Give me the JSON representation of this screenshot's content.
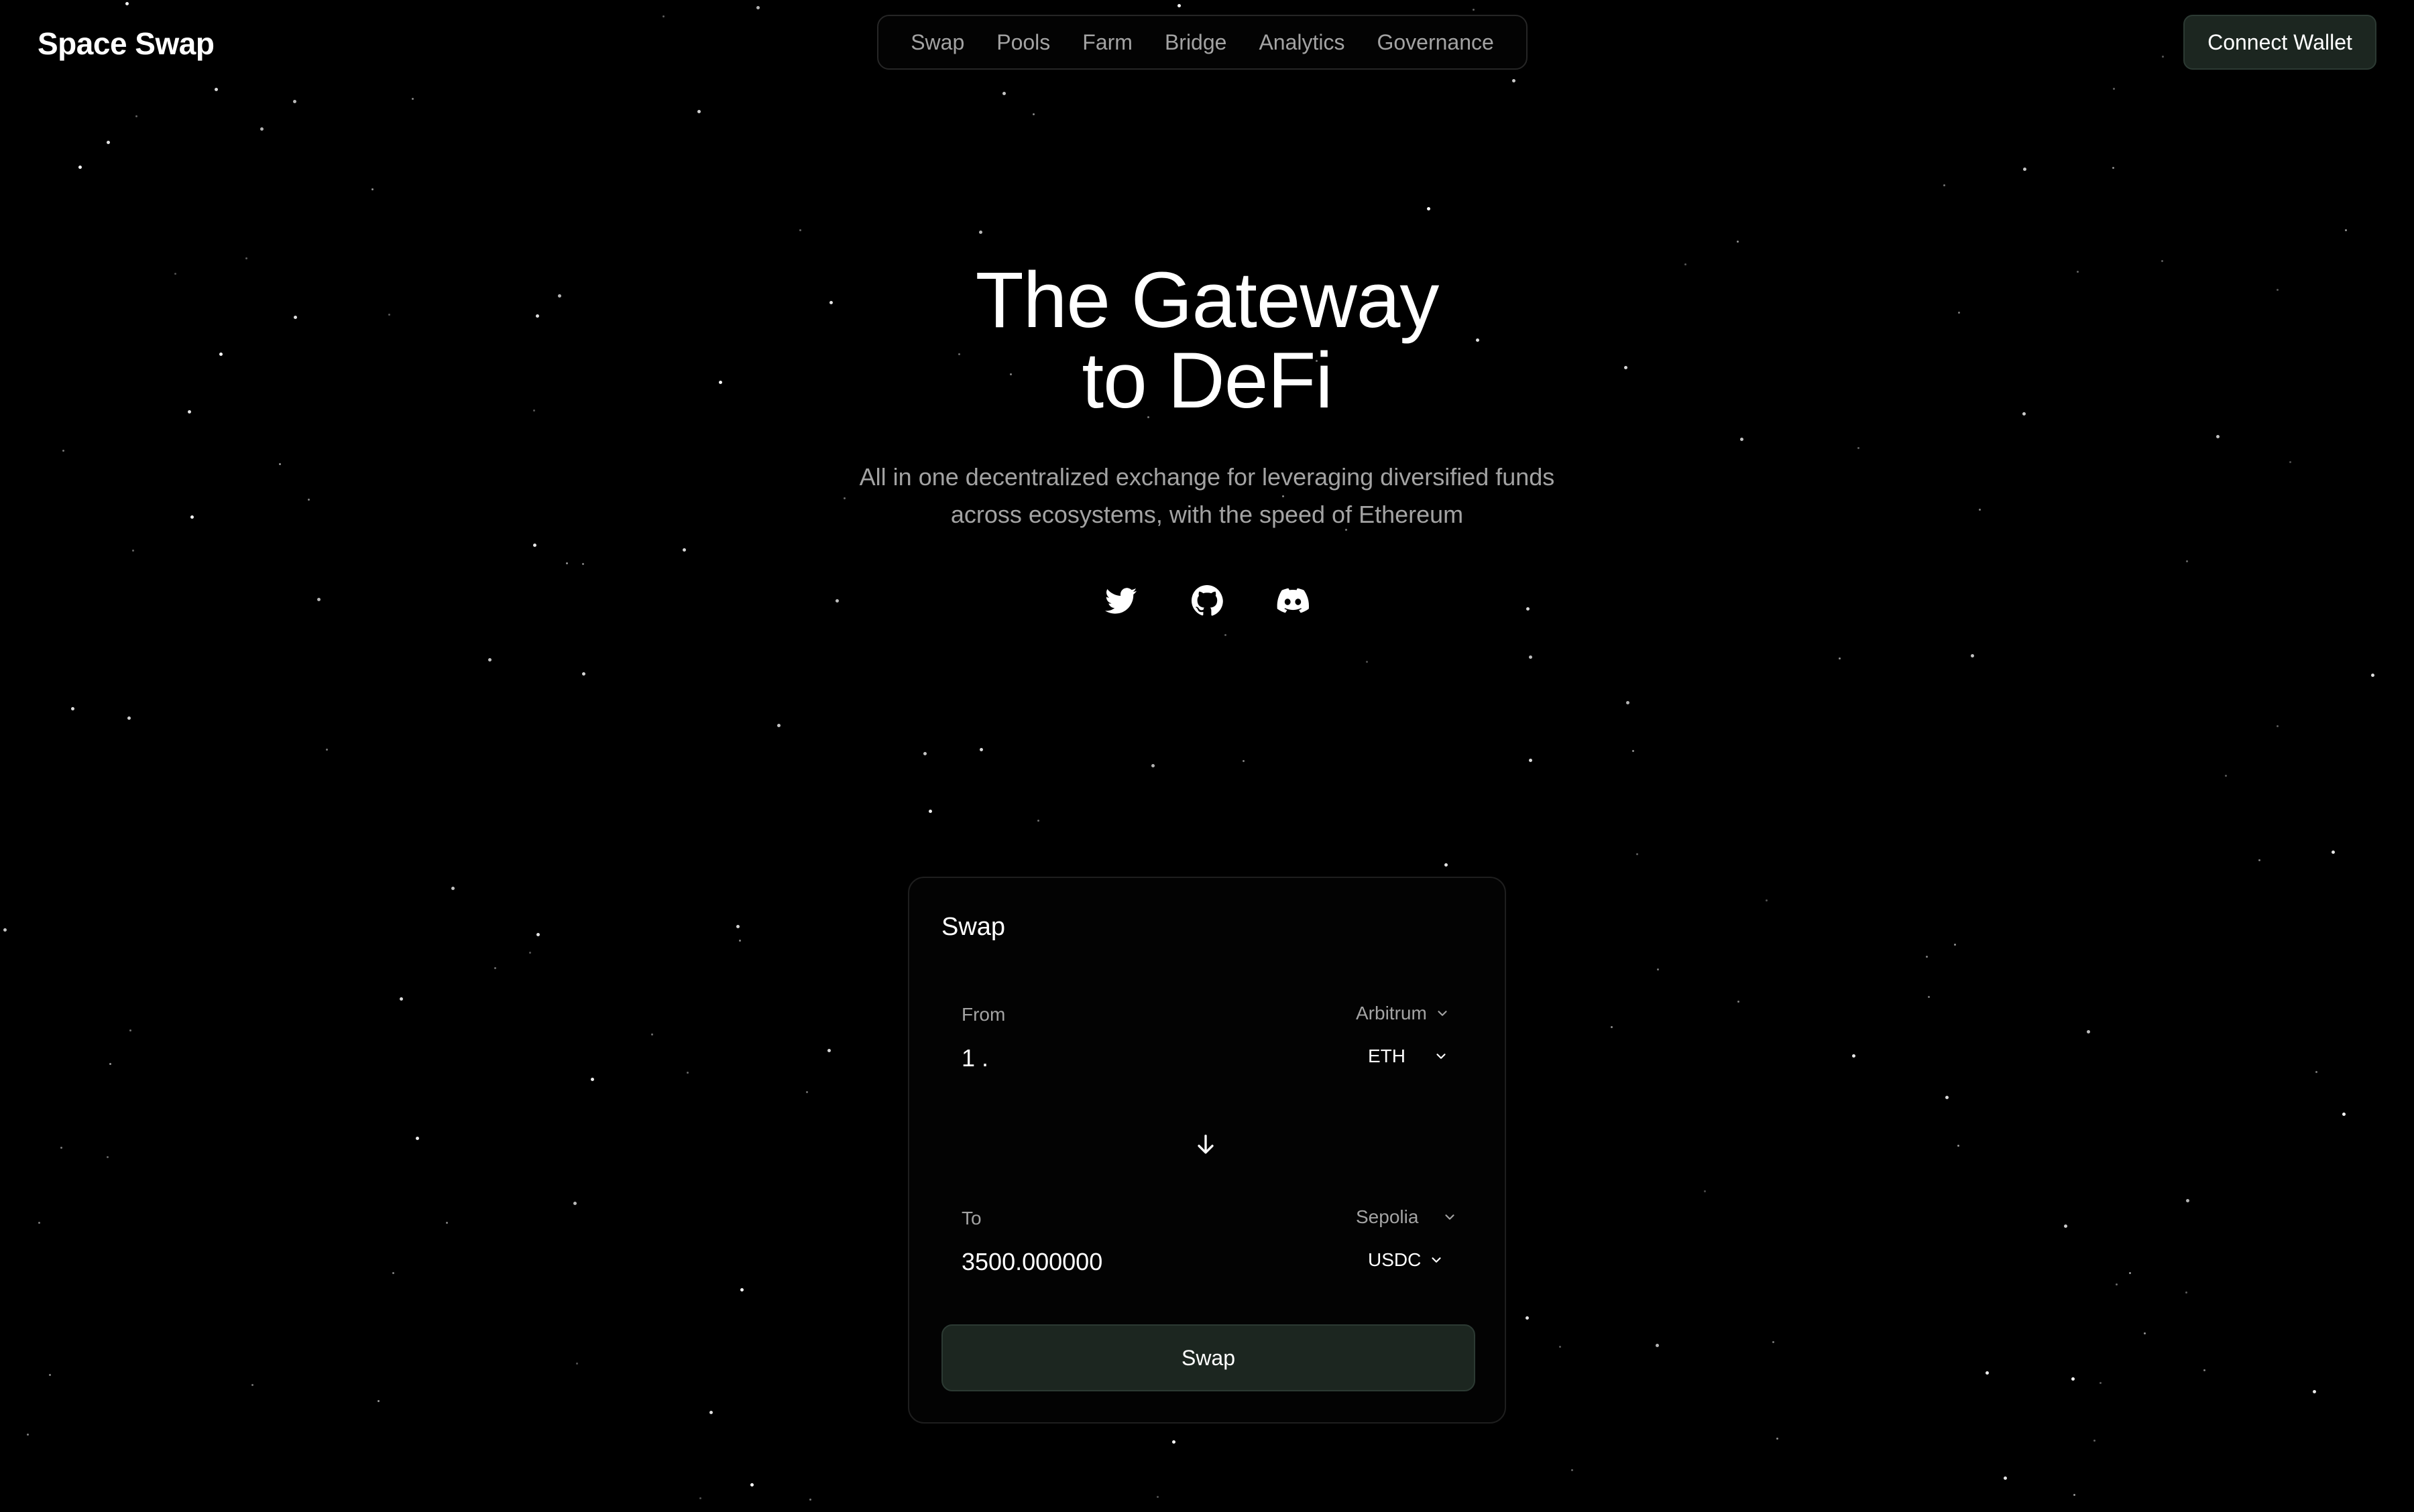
{
  "brand": "Space Swap",
  "nav": {
    "items": [
      "Swap",
      "Pools",
      "Farm",
      "Bridge",
      "Analytics",
      "Governance"
    ]
  },
  "header": {
    "connect_label": "Connect Wallet"
  },
  "hero": {
    "title_line1": "The Gateway",
    "title_line2": "to DeFi",
    "subtitle_line1": "All in one decentralized exchange for leveraging diversified funds",
    "subtitle_line2": "across ecosystems, with the speed of Ethereum"
  },
  "socials": [
    "twitter-icon",
    "github-icon",
    "discord-icon"
  ],
  "swap": {
    "title": "Swap",
    "from": {
      "label": "From",
      "amount": "1 .",
      "network": "Arbitrum",
      "token": "ETH"
    },
    "to": {
      "label": "To",
      "amount": "3500.000000",
      "network": "Sepolia",
      "token": "USDC"
    },
    "button_label": "Swap"
  },
  "colors": {
    "background": "#000000",
    "accent_button": "#1c2620",
    "muted_text": "#a3a3a3"
  }
}
